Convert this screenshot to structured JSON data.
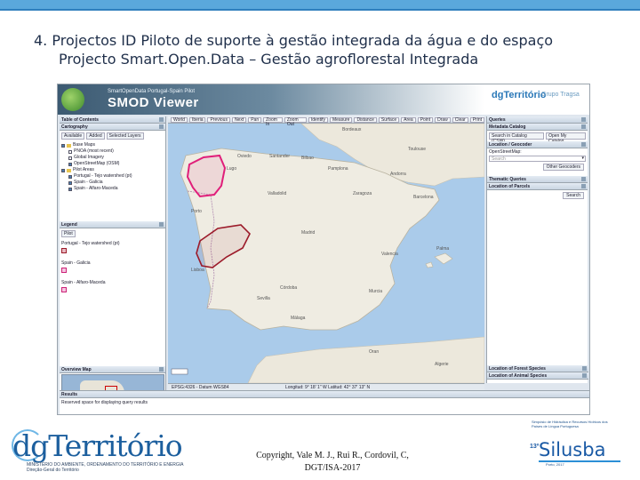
{
  "slide": {
    "title_line1": "4. Projectos ID Piloto de suporte à gestão integrada da água e do espaço",
    "title_line2": "Projecto Smart.Open.Data – Gestão agroflorestal Integrada",
    "copyright_line1": "Copyright, Vale M. J., Rui R., Cordovil, C,",
    "copyright_line2": "DGT/ISA-2017",
    "accent_color": "#5aa8dc"
  },
  "viewer": {
    "banner_subtitle": "SmartOpenData Portugal-Spain Pilot",
    "banner_title": "SMOD Viewer",
    "partner_logo": "dgTerritório",
    "partner_logo2": "Grupo Tragsa",
    "toolbar": [
      "World",
      "Iberia",
      "Previous",
      "Next",
      "Pan",
      "Zoom In",
      "Zoom Out",
      "Identify",
      "Measure",
      "Distance",
      "Surface",
      "Area",
      "Point",
      "Draw",
      "Clear",
      "Print"
    ],
    "left_panel": {
      "toc_title": "Table of Contents",
      "cartography_title": "Cartography",
      "tabs": [
        "Available",
        "Added",
        "Selected Layers"
      ],
      "layers": [
        {
          "label": "Base Maps",
          "type": "folder"
        },
        {
          "label": "PNOA (most recent)",
          "checked": false
        },
        {
          "label": "Global Imagery",
          "checked": false
        },
        {
          "label": "OpenStreetMap (OSM)",
          "checked": true
        },
        {
          "label": "Pilot Areas",
          "type": "folder"
        },
        {
          "label": "Portugal - Tejo watershed (pt)",
          "checked": true
        },
        {
          "label": "Spain - Galicia",
          "checked": true
        },
        {
          "label": "Spain - Alfaro-Maceda",
          "checked": true
        }
      ],
      "legend_title": "Legend",
      "legend_tab": "Pilot",
      "legend_items": [
        "Portugal - Tejo watershed (pt)",
        "Spain - Galicia",
        "Spain - Alfaro-Maceda"
      ],
      "overview_title": "Overview Map"
    },
    "right_panel": {
      "queries_title": "Queries",
      "metadata_title": "Metadata Catalog",
      "search_catalog_button": "Search in Catalog (CSW)",
      "open_catalog_button": "Open My Catalog",
      "location_title": "Location / Geocoder",
      "osm_label": "OpenStreetMap:",
      "search_placeholder": "Search",
      "other_geocoders_button": "Other Geocoders",
      "thematic_title": "Thematic Queries",
      "parcels_title": "Location of Parcels",
      "search_button": "Search",
      "forest_species": "Location of Forest Species",
      "animal_species": "Location of Animal Species"
    },
    "status": {
      "projection": "EPSG:4326 - Datum WGS84",
      "coordinates": "Longitud: 9° 18' 1\" W   Latitud: 42° 37' 13\" N"
    },
    "results": {
      "title": "Results",
      "text": "Reserved space for displaying query results"
    },
    "map_labels": [
      "Santander",
      "Bilbao",
      "Oviedo",
      "Lugo",
      "Pamplona",
      "Zaragoza",
      "Barcelona",
      "Porto",
      "Valladolid",
      "Madrid",
      "Lisboa",
      "Valencia",
      "Sevilla",
      "Málaga",
      "Palma",
      "Murcia",
      "Córdoba",
      "Algerie",
      "Oran",
      "Bordeaux",
      "Toulouse",
      "Andorra"
    ],
    "pilot_color": "#e01f7a",
    "tejo_color": "#9c1b2a"
  },
  "footer": {
    "dgt_logo": "dgTerritório",
    "dgt_ministry": "MINISTÉRIO DO AMBIENTE, ORDENAMENTO DO TERRITÓRIO E ENERGIA",
    "dgt_directorate": "Direção-Geral do Território",
    "silusba_small": "Simpósio de Hidráulica e Recursos Hídricos dos Países de Língua Portuguesa",
    "silusba_number": "13º",
    "silusba_name": "Silusba",
    "silusba_location": "Porto, 2017"
  }
}
